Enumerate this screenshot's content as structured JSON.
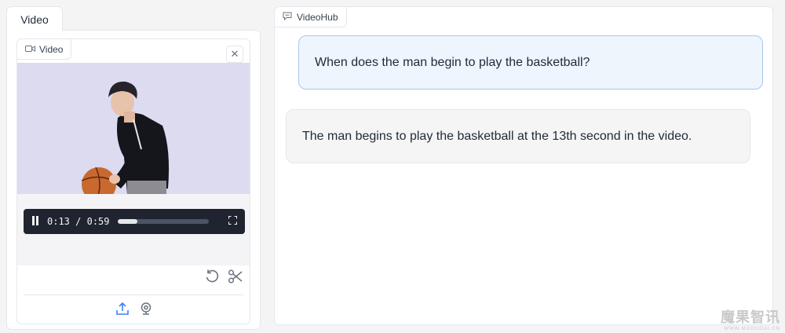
{
  "left": {
    "tab_label": "Video",
    "video_label": "Video",
    "player": {
      "current_time": "0:13",
      "separator": "/",
      "duration": "0:59",
      "progress_fraction": 0.22
    }
  },
  "right": {
    "hub_label": "VideoHub",
    "messages": [
      {
        "role": "user",
        "text": "When does the man begin to play the basketball?"
      },
      {
        "role": "assistant",
        "text": "The man begins to play the basketball at the 13th second in the video."
      }
    ]
  },
  "watermark": {
    "text": "魔果智讯",
    "sub": "WWW.MOGUOAI.CN"
  },
  "colors": {
    "accent": "#a9c7ee",
    "user_bubble": "#eef5fd",
    "bot_bubble": "#f5f5f6",
    "player_bg": "#1f2430",
    "icon_blue": "#3b82f6"
  },
  "icons": [
    "video-camera-icon",
    "close-icon",
    "pause-icon",
    "fullscreen-icon",
    "undo-icon",
    "scissors-icon",
    "upload-icon",
    "webcam-icon",
    "chat-icon"
  ]
}
